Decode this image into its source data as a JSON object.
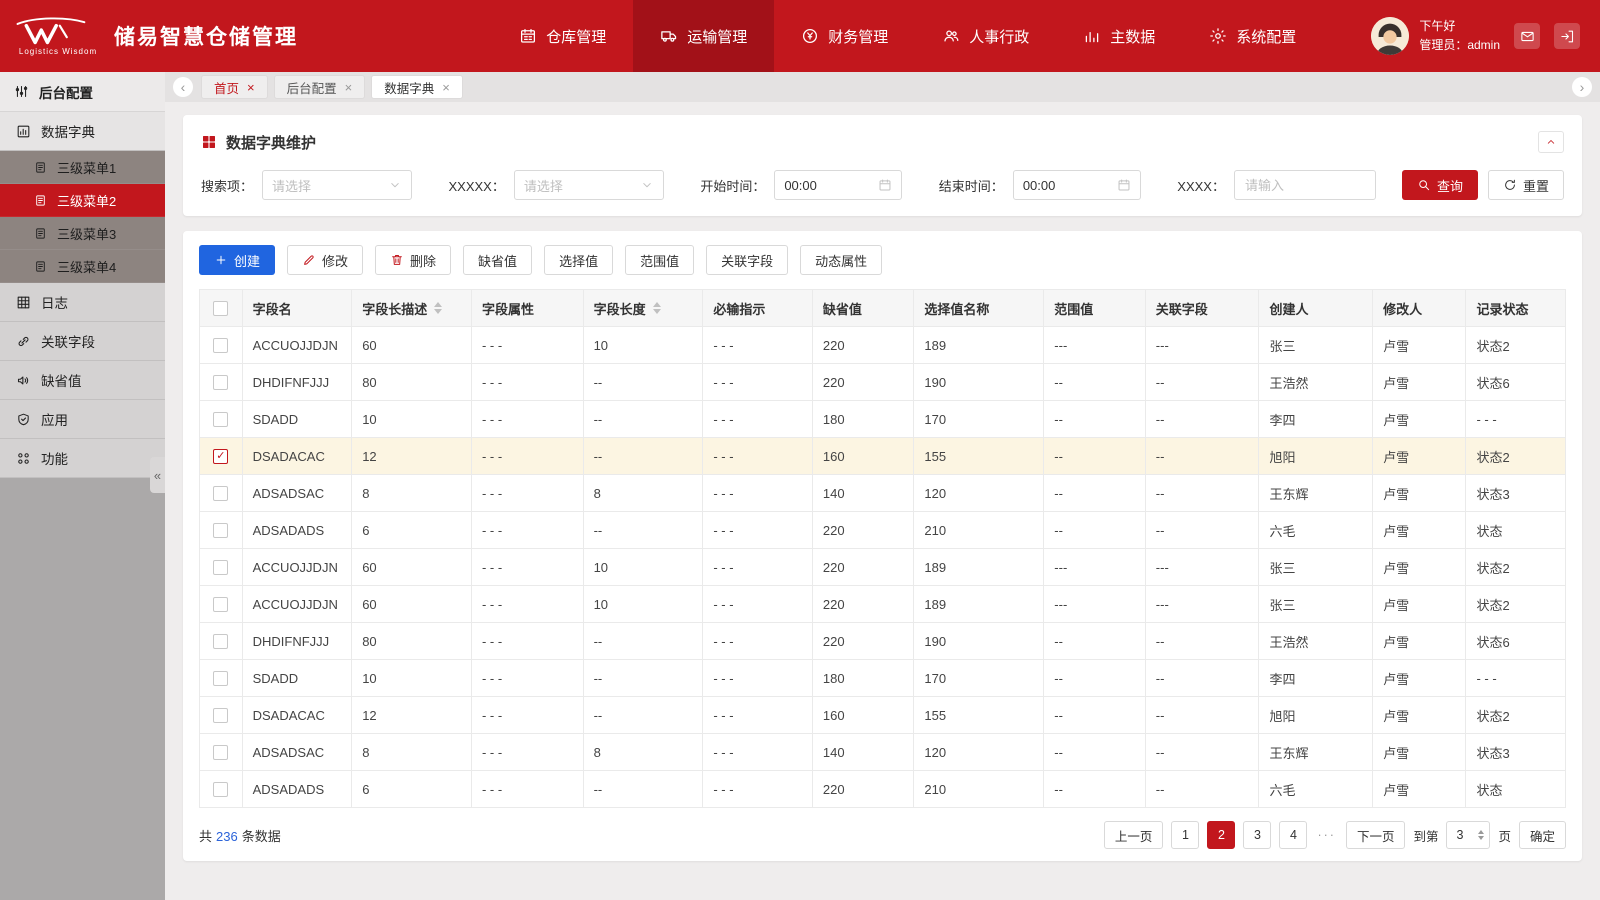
{
  "header": {
    "logo_title": "储易智慧仓储管理",
    "logo_subtitle": "Logistics Wisdom",
    "nav": [
      {
        "name": "warehouse",
        "label": "仓库管理",
        "icon": "warehouse-icon",
        "active": false
      },
      {
        "name": "transport",
        "label": "运输管理",
        "icon": "truck-icon",
        "active": true
      },
      {
        "name": "finance",
        "label": "财务管理",
        "icon": "finance-icon",
        "active": false
      },
      {
        "name": "hr",
        "label": "人事行政",
        "icon": "hr-icon",
        "active": false
      },
      {
        "name": "masterdata",
        "label": "主数据",
        "icon": "masterdata-icon",
        "active": false
      },
      {
        "name": "config",
        "label": "系统配置",
        "icon": "config-icon",
        "active": false
      }
    ],
    "greeting": "下午好",
    "admin_label": "管理员：admin"
  },
  "sidebar": {
    "items": [
      {
        "name": "backend-config",
        "label": "后台配置",
        "type": "group",
        "icon": "sliders-icon"
      },
      {
        "name": "data-dictionary",
        "label": "数据字典",
        "type": "item",
        "icon": "chart-icon",
        "active": true
      },
      {
        "name": "submenu-1",
        "label": "三级菜单1",
        "type": "subitem",
        "icon": "doc-icon"
      },
      {
        "name": "submenu-2",
        "label": "三级菜单2",
        "type": "subitem",
        "icon": "doc-icon",
        "selected": true
      },
      {
        "name": "submenu-3",
        "label": "三级菜单3",
        "type": "subitem",
        "icon": "doc-icon"
      },
      {
        "name": "submenu-4",
        "label": "三级菜单4",
        "type": "subitem",
        "icon": "doc-icon"
      },
      {
        "name": "logs",
        "label": "日志",
        "type": "item",
        "icon": "log-icon"
      },
      {
        "name": "related-fields",
        "label": "关联字段",
        "type": "item",
        "icon": "link-icon"
      },
      {
        "name": "default-values",
        "label": "缺省值",
        "type": "item",
        "icon": "default-icon"
      },
      {
        "name": "application",
        "label": "应用",
        "type": "item",
        "icon": "app-icon"
      },
      {
        "name": "functions",
        "label": "功能",
        "type": "item",
        "icon": "function-icon"
      }
    ]
  },
  "tabs": [
    {
      "name": "home",
      "label": "首页",
      "home": true
    },
    {
      "name": "backend-config",
      "label": "后台配置"
    },
    {
      "name": "data-dictionary",
      "label": "数据字典",
      "active": true
    }
  ],
  "panel": {
    "title": "数据字典维护"
  },
  "filters": {
    "groups": [
      {
        "name": "search-select",
        "label": "搜索项：",
        "type": "select",
        "placeholder": "请选择"
      },
      {
        "name": "xxxxx-select",
        "label": "XXXXX：",
        "type": "select",
        "placeholder": "请选择"
      },
      {
        "name": "start-time-input",
        "label": "开始时间：",
        "type": "time",
        "value": "00:00"
      },
      {
        "name": "end-time-input",
        "label": "结束时间：",
        "type": "time",
        "value": "00:00"
      },
      {
        "name": "xxxx-input",
        "label": "XXXX：",
        "type": "input",
        "placeholder": "请输入"
      }
    ],
    "query_label": "查询",
    "reset_label": "重置"
  },
  "actions": [
    {
      "name": "create-button",
      "label": "创建",
      "icon": "plus-icon",
      "style": "primary"
    },
    {
      "name": "edit-button",
      "label": "修改",
      "icon": "edit-icon",
      "style": "outline"
    },
    {
      "name": "delete-button",
      "label": "删除",
      "icon": "delete-icon",
      "style": "outline"
    },
    {
      "name": "default-value-button",
      "label": "缺省值",
      "style": "outline"
    },
    {
      "name": "select-value-button",
      "label": "选择值",
      "style": "outline"
    },
    {
      "name": "range-value-button",
      "label": "范围值",
      "style": "outline"
    },
    {
      "name": "related-field-button",
      "label": "关联字段",
      "style": "outline"
    },
    {
      "name": "dynamic-attr-button",
      "label": "动态属性",
      "style": "outline"
    }
  ],
  "table": {
    "columns": [
      {
        "label": "字段名"
      },
      {
        "label": "字段长描述",
        "sortable": true
      },
      {
        "label": "字段属性"
      },
      {
        "label": "字段长度",
        "sortable": true
      },
      {
        "label": "必输指示"
      },
      {
        "label": "缺省值"
      },
      {
        "label": "选择值名称"
      },
      {
        "label": "范围值"
      },
      {
        "label": "关联字段"
      },
      {
        "label": "创建人"
      },
      {
        "label": "修改人"
      },
      {
        "label": "记录状态"
      }
    ],
    "rows": [
      {
        "checked": false,
        "highlight": false,
        "cells": [
          "ACCUOJJDJN",
          "60",
          "- - -",
          "10",
          "- - -",
          "220",
          "189",
          "---",
          "---",
          "张三",
          "卢雪",
          "状态2"
        ]
      },
      {
        "checked": false,
        "highlight": false,
        "cells": [
          "DHDIFNFJJJ",
          "80",
          "- - -",
          "--",
          "- - -",
          "220",
          "190",
          "--",
          "--",
          "王浩然",
          "卢雪",
          "状态6"
        ]
      },
      {
        "checked": false,
        "highlight": false,
        "cells": [
          "SDADD",
          "10",
          "- - -",
          "--",
          "- - -",
          "180",
          "170",
          "--",
          "--",
          "李四",
          "卢雪",
          "- - -"
        ]
      },
      {
        "checked": true,
        "highlight": true,
        "cells": [
          "DSADACAC",
          "12",
          "- - -",
          "--",
          "- - -",
          "160",
          "155",
          "--",
          "--",
          "旭阳",
          "卢雪",
          "状态2"
        ]
      },
      {
        "checked": false,
        "highlight": false,
        "cells": [
          "ADSADSAC",
          "8",
          "- - -",
          "8",
          "- - -",
          "140",
          "120",
          "--",
          "--",
          "王东辉",
          "卢雪",
          "状态3"
        ]
      },
      {
        "checked": false,
        "highlight": false,
        "cells": [
          "ADSADADS",
          "6",
          "- - -",
          "--",
          "- - -",
          "220",
          "210",
          "--",
          "--",
          "六毛",
          "卢雪",
          "状态"
        ]
      },
      {
        "checked": false,
        "highlight": false,
        "cells": [
          "ACCUOJJDJN",
          "60",
          "- - -",
          "10",
          "- - -",
          "220",
          "189",
          "---",
          "---",
          "张三",
          "卢雪",
          "状态2"
        ]
      },
      {
        "checked": false,
        "highlight": false,
        "cells": [
          "ACCUOJJDJN",
          "60",
          "- - -",
          "10",
          "- - -",
          "220",
          "189",
          "---",
          "---",
          "张三",
          "卢雪",
          "状态2"
        ]
      },
      {
        "checked": false,
        "highlight": false,
        "cells": [
          "DHDIFNFJJJ",
          "80",
          "- - -",
          "--",
          "- - -",
          "220",
          "190",
          "--",
          "--",
          "王浩然",
          "卢雪",
          "状态6"
        ]
      },
      {
        "checked": false,
        "highlight": false,
        "cells": [
          "SDADD",
          "10",
          "- - -",
          "--",
          "- - -",
          "180",
          "170",
          "--",
          "--",
          "李四",
          "卢雪",
          "- - -"
        ]
      },
      {
        "checked": false,
        "highlight": false,
        "cells": [
          "DSADACAC",
          "12",
          "- - -",
          "--",
          "- - -",
          "160",
          "155",
          "--",
          "--",
          "旭阳",
          "卢雪",
          "状态2"
        ]
      },
      {
        "checked": false,
        "highlight": false,
        "cells": [
          "ADSADSAC",
          "8",
          "- - -",
          "8",
          "- - -",
          "140",
          "120",
          "--",
          "--",
          "王东辉",
          "卢雪",
          "状态3"
        ]
      },
      {
        "checked": false,
        "highlight": false,
        "cells": [
          "ADSADADS",
          "6",
          "- - -",
          "--",
          "- - -",
          "220",
          "210",
          "--",
          "--",
          "六毛",
          "卢雪",
          "状态"
        ]
      }
    ]
  },
  "pagination": {
    "total_prefix": "共",
    "total_count": "236",
    "total_suffix": "条数据",
    "prev_label": "上一页",
    "pages": [
      "1",
      "2",
      "3",
      "4"
    ],
    "active_page": "2",
    "ellipsis": "···",
    "next_label": "下一页",
    "goto_label": "到第",
    "goto_value": "3",
    "page_unit": "页",
    "confirm_label": "确定"
  }
}
